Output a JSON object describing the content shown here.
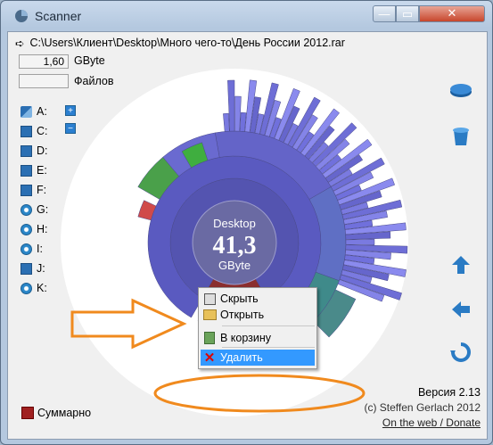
{
  "window": {
    "title": "Scanner"
  },
  "path": {
    "value": "C:\\Users\\Клиент\\Desktop\\Много чего-то\\День России 2012.rar"
  },
  "size": {
    "value": "1,60",
    "unit": "GByte"
  },
  "files": {
    "value": "",
    "label": "Файлов"
  },
  "drives": [
    "A:",
    "C:",
    "D:",
    "E:",
    "F:",
    "G:",
    "H:",
    "I:",
    "J:",
    "K:"
  ],
  "center": {
    "name": "Desktop",
    "value": "41,3",
    "unit": "GByte"
  },
  "context_menu": {
    "items": [
      "Скрыть",
      "Открыть",
      "В корзину",
      "Удалить"
    ]
  },
  "footer": {
    "summary_label": "Суммарно",
    "version": "Версия 2.13",
    "copyright": "(c) Steffen Gerlach 2012",
    "link": "On the web / Donate"
  },
  "colors": {
    "annotation": "#f08a1e",
    "selected_menu": "#3399ff"
  }
}
